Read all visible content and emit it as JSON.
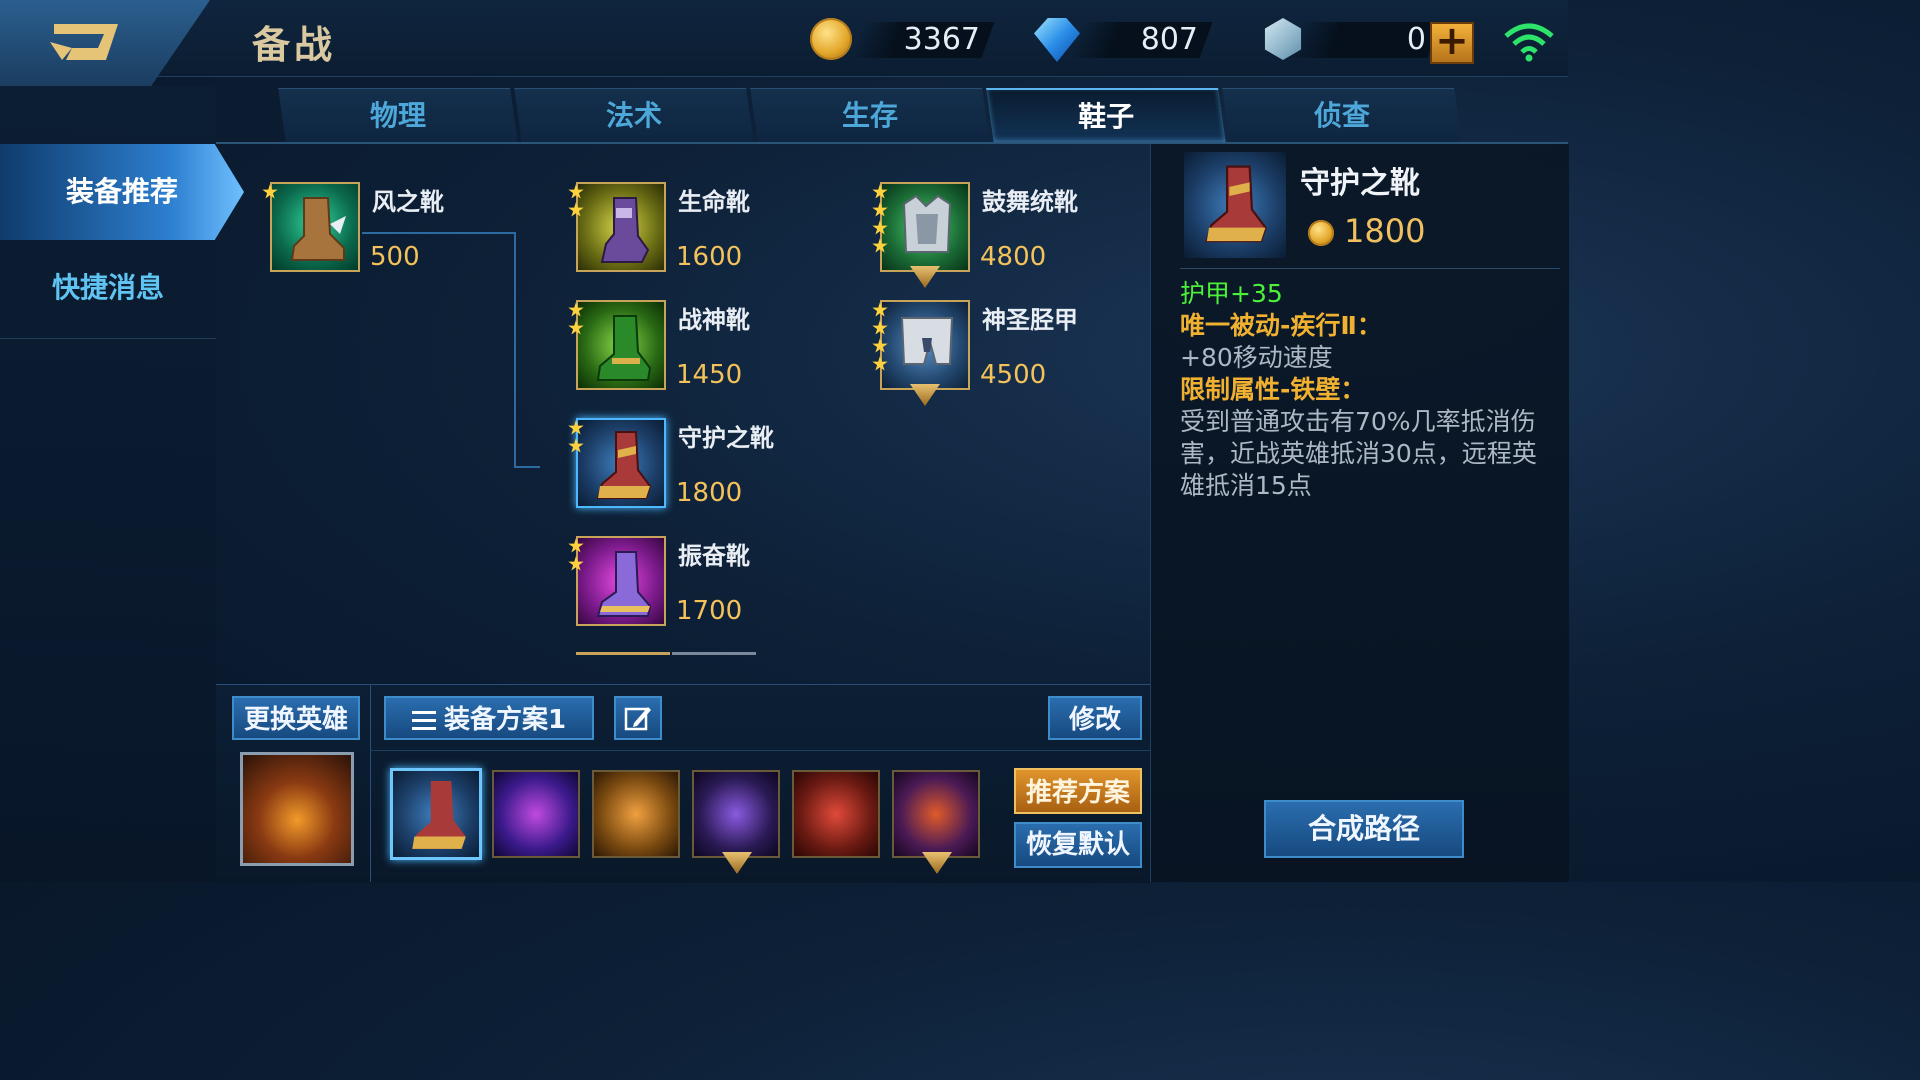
{
  "header": {
    "title": "备战"
  },
  "currency": {
    "gold": "3367",
    "diamonds": "807",
    "tokens": "0"
  },
  "leftnav": {
    "items": [
      {
        "label": "装备推荐"
      },
      {
        "label": "快捷消息"
      }
    ]
  },
  "tabs": [
    {
      "label": "物理"
    },
    {
      "label": "法术"
    },
    {
      "label": "生存"
    },
    {
      "label": "鞋子"
    },
    {
      "label": "侦查"
    }
  ],
  "items": {
    "wind": {
      "name": "风之靴",
      "price": "500"
    },
    "life": {
      "name": "生命靴",
      "price": "1600"
    },
    "war": {
      "name": "战神靴",
      "price": "1450"
    },
    "guard": {
      "name": "守护之靴",
      "price": "1800"
    },
    "vib": {
      "name": "振奋靴",
      "price": "1700"
    },
    "drum": {
      "name": "鼓舞统靴",
      "price": "4800"
    },
    "holy": {
      "name": "神圣胫甲",
      "price": "4500"
    }
  },
  "detail": {
    "name": "守护之靴",
    "price": "1800",
    "stat": "护甲+35",
    "passive1_title": "唯一被动-疾行Ⅱ：",
    "passive1_text": "+80移动速度",
    "passive2_title": "限制属性-铁壁：",
    "passive2_text": "受到普通攻击有70%几率抵消伤害，近战英雄抵消30点，远程英雄抵消15点"
  },
  "bottom": {
    "change_hero": "更换英雄",
    "scheme": "装备方案1",
    "modify": "修改",
    "recommend": "推荐方案",
    "restore": "恢复默认",
    "craft_path": "合成路径"
  }
}
